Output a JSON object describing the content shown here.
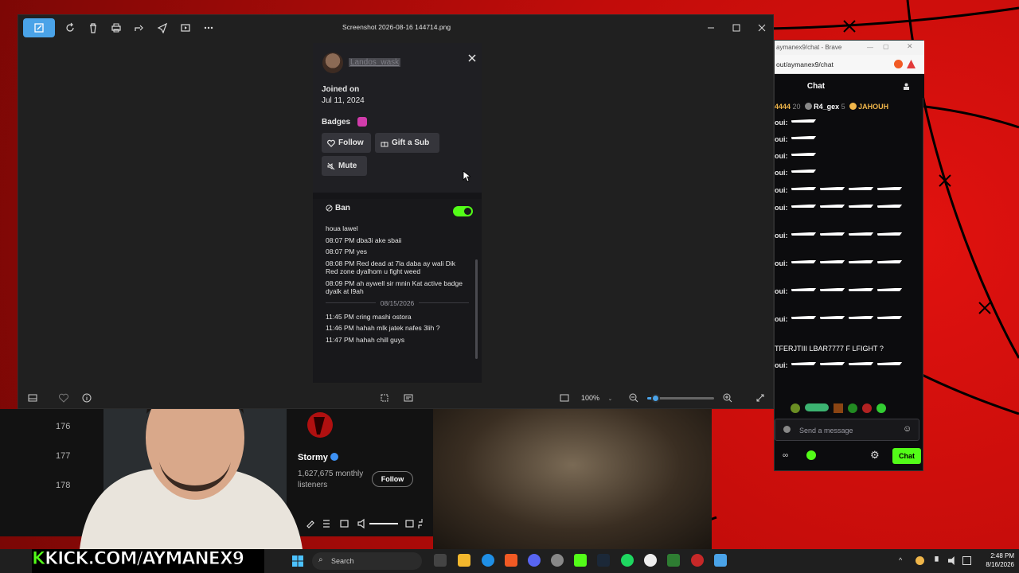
{
  "desktop": {
    "accent": "#d8100d"
  },
  "viewer": {
    "title": "Screenshot 2026-08-16 144714.png",
    "zoom_label": "100%",
    "zoom_level_percent": 100,
    "zoom_slider_fraction": 0.12,
    "toolbar_icons": [
      "edit-icon",
      "rotate-icon",
      "delete-icon",
      "print-icon",
      "share-icon",
      "send-icon",
      "slideshow-icon",
      "more-icon"
    ],
    "accent": "#4aa3e8"
  },
  "card": {
    "username": "Landos_wask",
    "joined_label": "Joined on",
    "joined_date": "Jul 11, 2024",
    "badges_label": "Badges",
    "follow_label": "Follow",
    "gift_label": "Gift a Sub",
    "mute_label": "Mute",
    "ban_label": "Ban",
    "ban_enabled": true,
    "messages_before": [
      "houa lawel",
      "08:07 PM dba3i ake sbaii",
      "08:07 PM yes",
      "08:08 PM Red dead at 7la daba ay wali Dik Red zone dyalhom u fight weed",
      "08:09 PM ah aywell sir mnin Kat active badge dyalk at l9ah"
    ],
    "date_separator": "08/15/2026",
    "messages_after": [
      "11:45 PM cring mashi ostora",
      "11:46 PM hahah mlk jatek nafes 3lih ?",
      "11:47 PM hahah chill guys"
    ],
    "toggle_color": "#53fc18"
  },
  "chat": {
    "window_title": "aymanex9/chat - Brave",
    "url": "out/aymanex9/chat",
    "title": "Chat",
    "gifters": [
      {
        "name": "4444",
        "count": "20",
        "color": "#f0b64a"
      },
      {
        "name": "R4_gex",
        "count": "5",
        "color": "#ffffff"
      },
      {
        "name": "JAHOUH",
        "count": "",
        "color": "#f0b64a"
      }
    ],
    "lines": [
      {
        "user": "oui:",
        "emotes": 1
      },
      {
        "user": "oui:",
        "emotes": 1
      },
      {
        "user": "oui:",
        "emotes": 1
      },
      {
        "user": "oui:",
        "emotes": 1
      },
      {
        "user": "oui:",
        "emotes": 4
      },
      {
        "user": "oui:",
        "emotes": 4
      },
      {
        "user": "oui:",
        "emotes": 4
      },
      {
        "user": "oui:",
        "emotes": 4
      },
      {
        "user": "oui:",
        "emotes": 4
      },
      {
        "user": "oui:",
        "emotes": 4
      }
    ],
    "fight_line": "TFERJTIII LBAR7777 F LFIGHT ?",
    "last_user": "oui:",
    "input_placeholder": "Send a message",
    "send_label": "Chat",
    "accent": "#53fc18"
  },
  "spotify": {
    "ranks": [
      "176",
      "177",
      "178"
    ],
    "artist_name": "Stormy",
    "listeners": "1,627,675 monthly listeners",
    "follow_label": "Follow"
  },
  "overlay": {
    "kick_k": "K",
    "kick_text": "KICK.COM/AYMANEX9"
  },
  "taskbar": {
    "search_placeholder": "Search",
    "time": "2:48 PM",
    "date": "8/16/2026"
  }
}
